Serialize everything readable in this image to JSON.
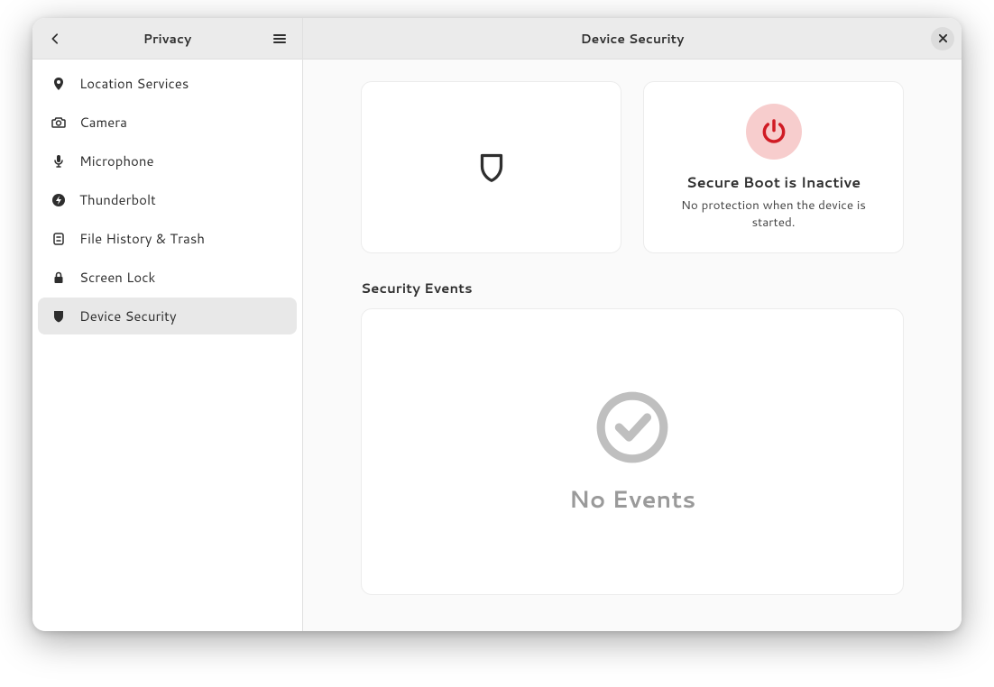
{
  "sidebar": {
    "title": "Privacy",
    "items": [
      {
        "label": "Location Services",
        "icon": "location-icon"
      },
      {
        "label": "Camera",
        "icon": "camera-icon"
      },
      {
        "label": "Microphone",
        "icon": "microphone-icon"
      },
      {
        "label": "Thunderbolt",
        "icon": "thunderbolt-icon"
      },
      {
        "label": "File History & Trash",
        "icon": "file-history-icon"
      },
      {
        "label": "Screen Lock",
        "icon": "lock-icon"
      },
      {
        "label": "Device Security",
        "icon": "shield-icon",
        "selected": true
      }
    ]
  },
  "main": {
    "title": "Device Security",
    "cards": {
      "left": {
        "icon": "shield-outline-icon"
      },
      "right": {
        "icon": "power-danger-icon",
        "title": "Secure Boot is Inactive",
        "subtitle": "No protection when the device is started."
      }
    },
    "events": {
      "heading": "Security Events",
      "empty_text": "No Events"
    }
  }
}
